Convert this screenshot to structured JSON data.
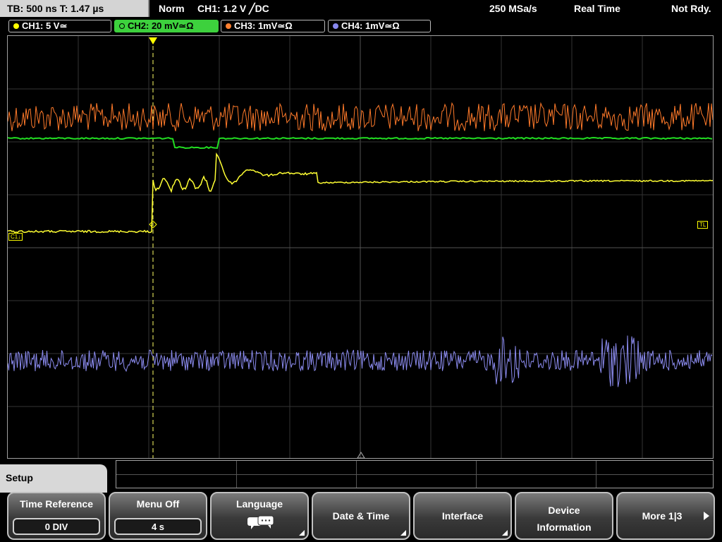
{
  "top": {
    "timebase": "TB: 500 ns  T: 1.47 µs",
    "trigger_mode": "Norm",
    "trigger_info": "CH1: 1.2 V ╱DC",
    "sample_rate": "250 MSa/s",
    "acq_mode": "Real Time",
    "status": "Not Rdy."
  },
  "channels": [
    {
      "label": "CH1: 5 V≃",
      "color": "#ffff00",
      "active": false
    },
    {
      "label": "CH2: 20 mV≃Ω",
      "color": "#3dd13d",
      "active": true
    },
    {
      "label": "CH3: 1mV≃Ω",
      "color": "#ff8030",
      "active": false
    },
    {
      "label": "CH4: 1mV≃Ω",
      "color": "#8888ee",
      "active": false
    }
  ],
  "markers": {
    "ch1": "C1↓",
    "trigger_level": "TL",
    "trigger_pos": "T"
  },
  "menu": {
    "title": "Setup",
    "time_reference": {
      "label": "Time Reference",
      "value": "0 DIV"
    },
    "menu_off": {
      "label": "Menu Off",
      "value": "4 s"
    },
    "language": {
      "label": "Language"
    },
    "date_time": {
      "label": "Date & Time"
    },
    "interface": {
      "label": "Interface"
    },
    "device_info": {
      "line1": "Device",
      "line2": "Information"
    },
    "more": {
      "label": "More 1|3"
    }
  }
}
